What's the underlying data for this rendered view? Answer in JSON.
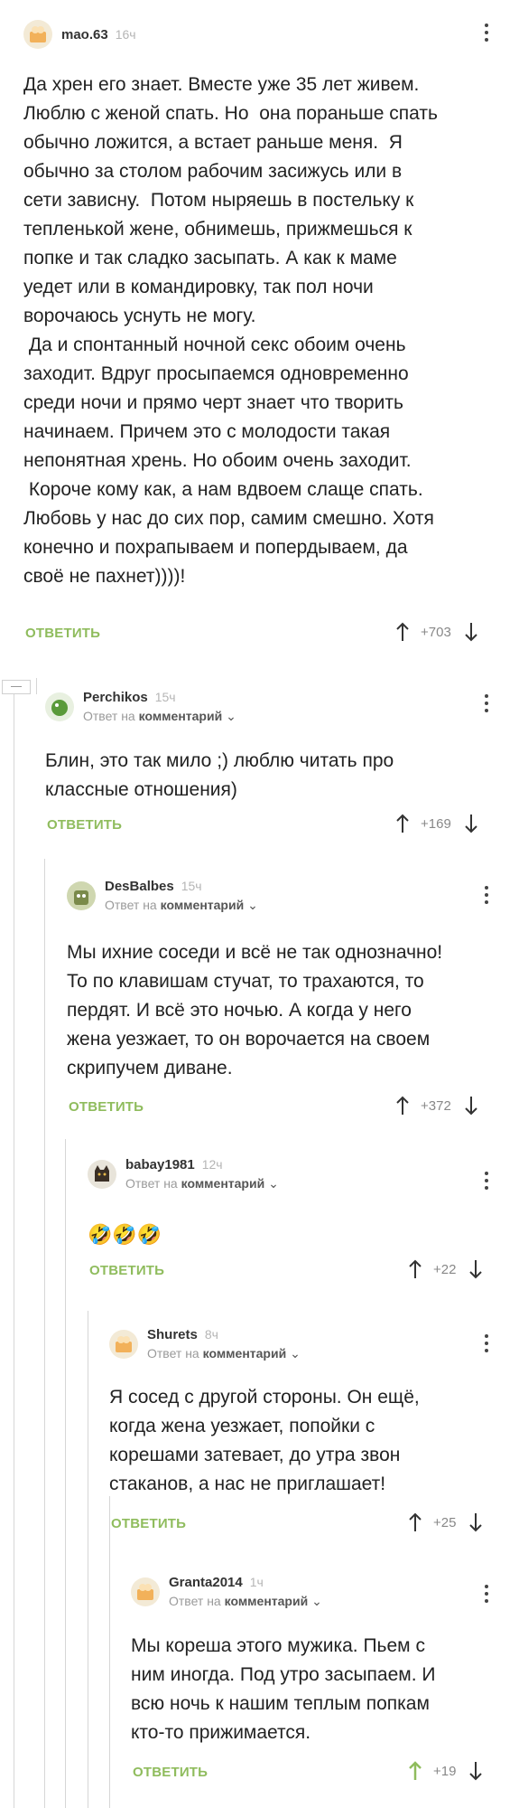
{
  "comments": [
    {
      "author": "mao.63",
      "time": "16ч",
      "text": "Да хрен его знает. Вместе уже 35 лет живем.\nЛюблю с женой спать. Но  она пораньше спать\nобычно ложится, а встает раньше меня.  Я\nобычно за столом рабочим засижусь или в\nсети зависну.  Потом ныряешь в постельку к\nтепленькой жене, обнимешь, прижмешься к\nпопке и так сладко засыпать. А как к маме\nуедет или в командировку, так пол ночи\nворочаюсь уснуть не могу.\n Да и спонтанный ночной секс обоим очень\nзаходит. Вдруг просыпаемся одновременно\nсреди ночи и прямо черт знает что творить\nначинаем. Причем это с молодости такая\nнепонятная хрень. Но обоим очень заходит.\n Короче кому как, а нам вдвоем слаще спать.\nЛюбовь у нас до сих пор, самим смешно. Хотя\nконечно и похрапываем и попердываем, да\nсвоё не пахнет))))!",
      "reply_label": "ОТВЕТИТЬ",
      "votes": "+703"
    },
    {
      "author": "Perchikos",
      "time": "15ч",
      "reply_prefix": "Ответ на",
      "reply_target": "комментарий",
      "text": "Блин, это так мило ;) люблю читать про\nклассные отношения)",
      "reply_label": "ОТВЕТИТЬ",
      "votes": "+169"
    },
    {
      "author": "DesBalbes",
      "time": "15ч",
      "reply_prefix": "Ответ на",
      "reply_target": "комментарий",
      "text": "Мы ихние соседи и всё не так однозначно!\nТо по клавишам стучат, то трахаются, то\nпердят. И всё это ночью. А когда у него\nжена уезжает, то он ворочается на своем\nскрипучем диване.",
      "reply_label": "ОТВЕТИТЬ",
      "votes": "+372"
    },
    {
      "author": "babay1981",
      "time": "12ч",
      "reply_prefix": "Ответ на",
      "reply_target": "комментарий",
      "text": "🤣🤣🤣",
      "reply_label": "ОТВЕТИТЬ",
      "votes": "+22"
    },
    {
      "author": "Shurets",
      "time": "8ч",
      "reply_prefix": "Ответ на",
      "reply_target": "комментарий",
      "text": "Я сосед с другой стороны. Он ещё,\nкогда жена уезжает, попойки с\nкорешами затевает, до утра звон\nстаканов, а нас не приглашает!",
      "reply_label": "ОТВЕТИТЬ",
      "votes": "+25"
    },
    {
      "author": "Granta2014",
      "time": "1ч",
      "reply_prefix": "Ответ на",
      "reply_target": "комментарий",
      "text": "Мы кореша этого мужика. Пьем с\nним иногда. Под утро засыпаем. И\nвсю ночь к нашим теплым попкам\nкто-то прижимается.",
      "reply_label": "ОТВЕТИТЬ",
      "votes": "+19"
    }
  ],
  "colors": {
    "reply_button": "#8fbc5d",
    "upvoted_arrow": "#8fbc5d",
    "thread_line": "#d6d6d6"
  }
}
